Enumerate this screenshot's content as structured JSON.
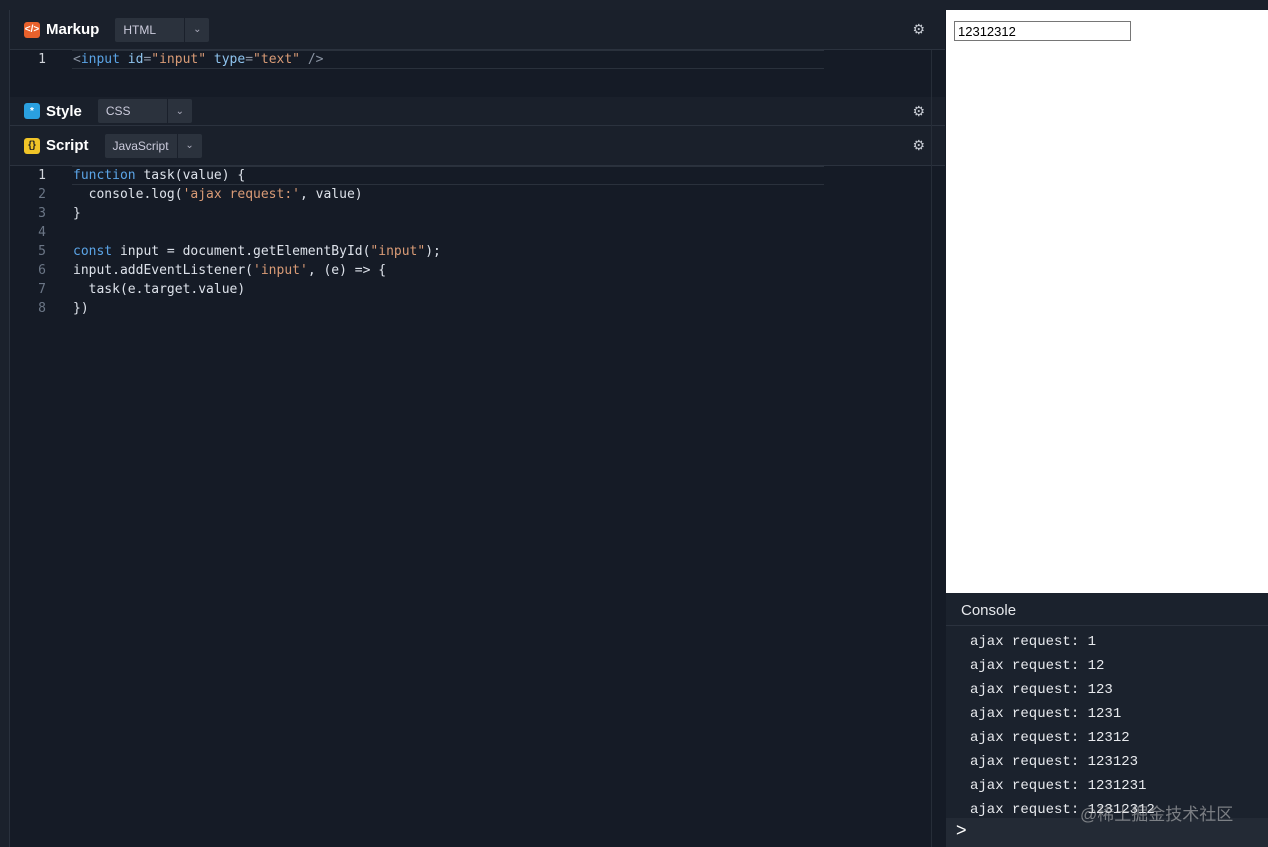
{
  "panels": {
    "markup": {
      "title": "Markup",
      "icon": "</>",
      "lang": "HTML",
      "icon_color": "#e8612c"
    },
    "style": {
      "title": "Style",
      "icon": "*",
      "lang": "CSS",
      "icon_color": "#2aa0e0"
    },
    "script": {
      "title": "Script",
      "icon": "{}",
      "lang": "JavaScript",
      "icon_color": "#f0c428"
    }
  },
  "markup_code": [
    [
      [
        "punc",
        "<"
      ],
      [
        "kw",
        "input"
      ],
      [
        "plain",
        " "
      ],
      [
        "attr",
        "id"
      ],
      [
        "punc",
        "="
      ],
      [
        "str",
        "\"input\""
      ],
      [
        "plain",
        " "
      ],
      [
        "attr",
        "type"
      ],
      [
        "punc",
        "="
      ],
      [
        "str",
        "\"text\""
      ],
      [
        "plain",
        " "
      ],
      [
        "punc",
        "/>"
      ]
    ]
  ],
  "script_code": [
    [
      [
        "kw",
        "function"
      ],
      [
        "plain",
        " task(value) {"
      ]
    ],
    [
      [
        "plain",
        "  console.log("
      ],
      [
        "str",
        "'ajax request:'"
      ],
      [
        "plain",
        ", value)"
      ]
    ],
    [
      [
        "plain",
        "}"
      ]
    ],
    [],
    [
      [
        "kw",
        "const"
      ],
      [
        "plain",
        " input = document.getElementById("
      ],
      [
        "str",
        "\"input\""
      ],
      [
        "plain",
        ");"
      ]
    ],
    [
      [
        "plain",
        "input.addEventListener("
      ],
      [
        "str",
        "'input'"
      ],
      [
        "plain",
        ", (e) => {"
      ]
    ],
    [
      [
        "plain",
        "  task(e.target.value)"
      ]
    ],
    [
      [
        "plain",
        "})"
      ]
    ]
  ],
  "preview": {
    "input_value": "12312312"
  },
  "console": {
    "title": "Console",
    "lines": [
      "ajax request: 1",
      "ajax request: 12",
      "ajax request: 123",
      "ajax request: 1231",
      "ajax request: 12312",
      "ajax request: 123123",
      "ajax request: 1231231",
      "ajax request: 12312312"
    ],
    "prompt": ">"
  },
  "watermark": "@稀土掘金技术社区"
}
